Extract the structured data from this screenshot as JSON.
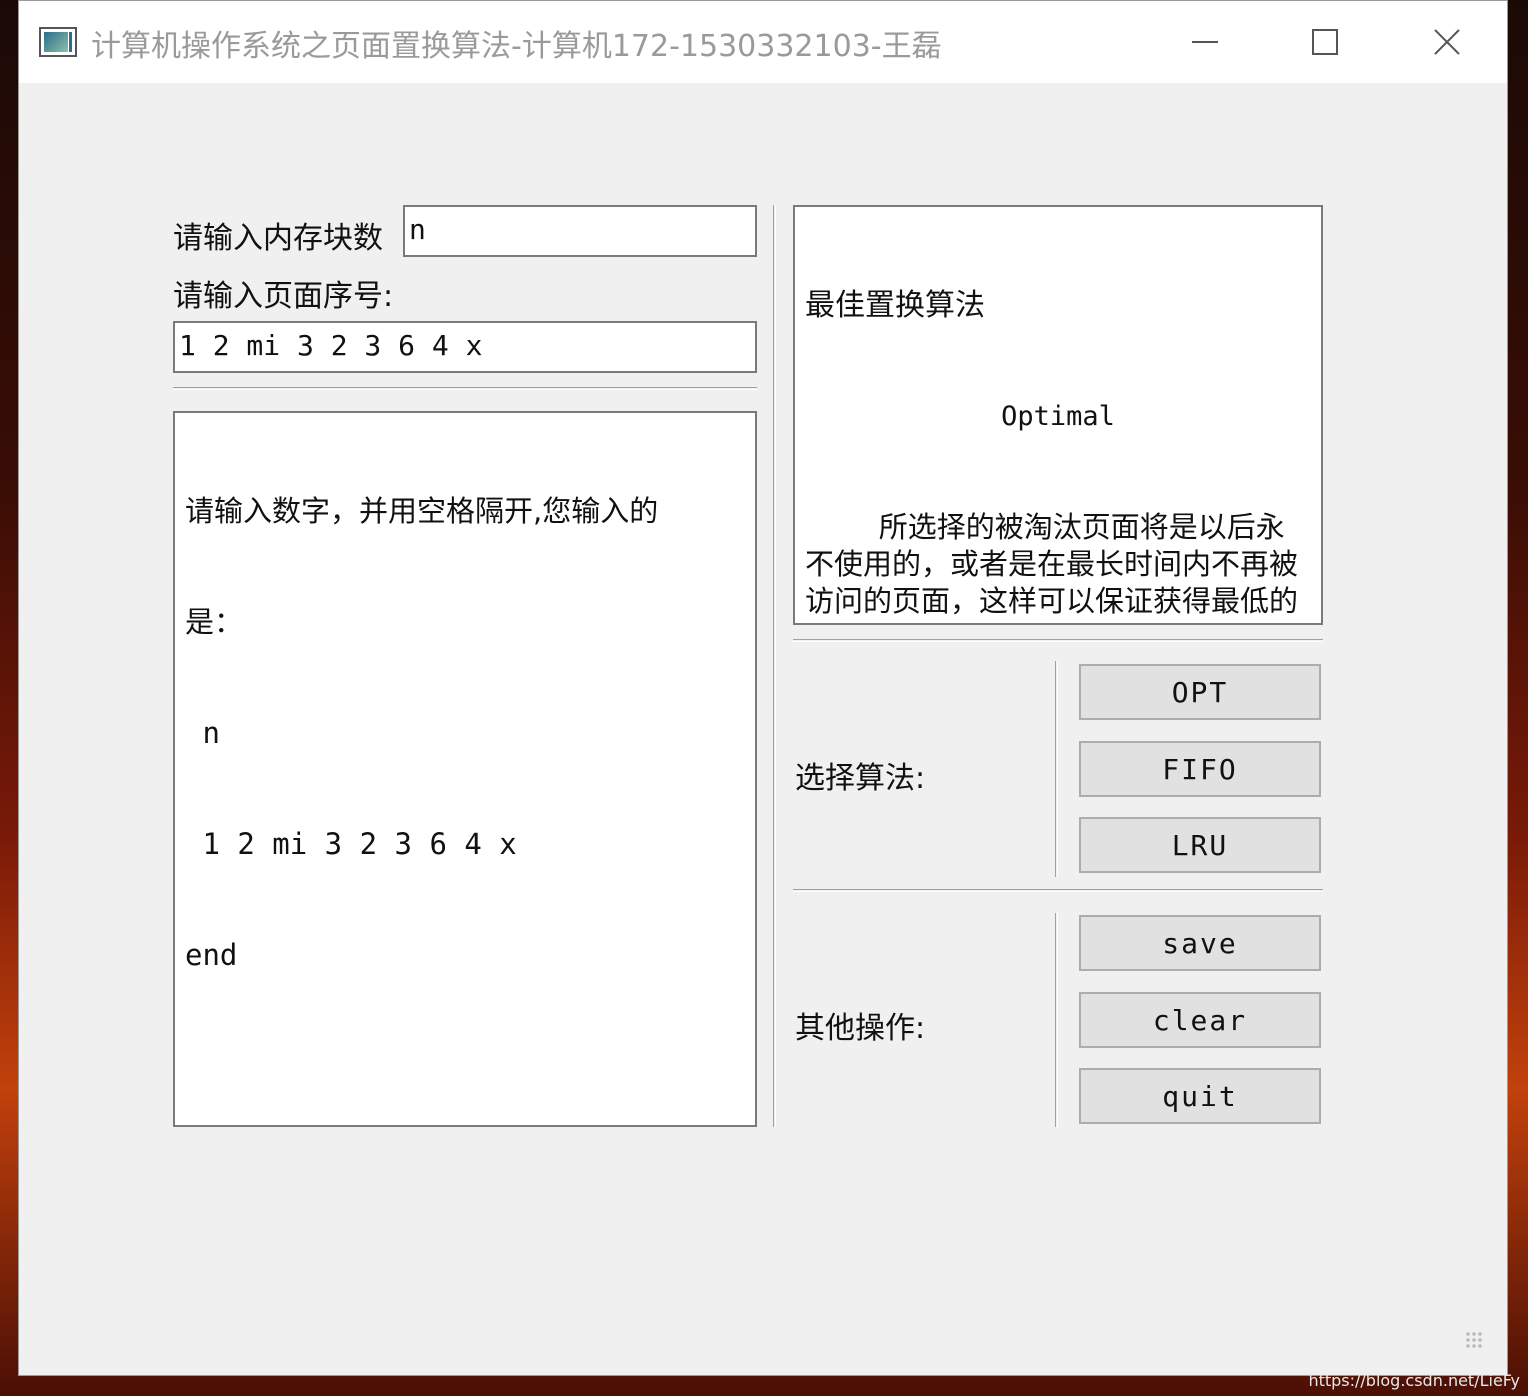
{
  "window": {
    "title": "计算机操作系统之页面置换算法-计算机172-1530332103-王磊",
    "controls": [
      "minimize",
      "maximize",
      "close"
    ]
  },
  "inputs": {
    "memory_blocks_label": "请输入内存块数",
    "memory_blocks_value": "n",
    "page_sequence_label": "请输入页面序号:",
    "page_sequence_value": "1 2 mi 3 2 3 6 4 x"
  },
  "output": {
    "lines": [
      "请输入数字，并用空格隔开,您输入的",
      "是：",
      " n",
      " 1 2 mi 3 2 3 6 4 x",
      "end"
    ]
  },
  "description": {
    "title": "最佳置换算法",
    "subtitle": "Optimal",
    "body": "        所选择的被淘汰页面将是以后永不使用的，或者是在最长时间内不再被访问的页面，这样可以保证获得最低的缺页率。是一种理想的页面置换算法，但是因为无法预知未来，因此现实中无法实现。"
  },
  "algorithms": {
    "label": "选择算法:",
    "buttons": [
      "OPT",
      "FIFO",
      "LRU"
    ]
  },
  "operations": {
    "label": "其他操作:",
    "buttons": [
      "save",
      "clear",
      "quit"
    ]
  },
  "watermark": "https://blog.csdn.net/LieFy"
}
